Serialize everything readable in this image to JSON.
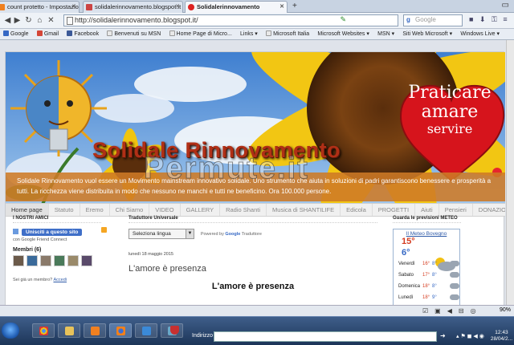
{
  "browser": {
    "tabs": [
      {
        "label": "count protetto - Impostazioni...",
        "icon": "blogger-icon",
        "active": false
      },
      {
        "label": "solidalerinnovamento.blogspot.it - Commu...",
        "icon": "blogger-icon",
        "active": false
      },
      {
        "label": "Solidalerinnovamento",
        "icon": "heart-icon",
        "active": true
      }
    ],
    "new_tab": "+",
    "url": "http://solidalerinnovamento.blogspot.it/",
    "search_placeholder": "Google",
    "bookmarks": [
      {
        "label": "Google",
        "icon": "google-icon",
        "color": "#3568c4"
      },
      {
        "label": "Gmail",
        "icon": "gmail-icon",
        "color": "#d44638"
      },
      {
        "label": "Facebook",
        "icon": "facebook-icon",
        "color": "#3b5998"
      },
      {
        "label": "Benvenuti su MSN",
        "icon": "msn-icon",
        "color": "#7a9bc8"
      },
      {
        "label": "Home Page di Micro...",
        "icon": "page-icon",
        "color": "#eeeeee"
      },
      {
        "label": "Links ▾",
        "icon": "",
        "color": ""
      },
      {
        "label": "Microsoft Italia",
        "icon": "page-icon",
        "color": "#eeeeee"
      },
      {
        "label": "Microsoft Websites ▾",
        "icon": "",
        "color": ""
      },
      {
        "label": "MSN ▾",
        "icon": "",
        "color": ""
      },
      {
        "label": "Siti Web Microsoft ▾",
        "icon": "",
        "color": ""
      },
      {
        "label": "Windows Live ▾",
        "icon": "",
        "color": ""
      }
    ]
  },
  "blog": {
    "title": "Solidale Rinnovamento",
    "watermark": "Permute.it",
    "heart_lines": [
      "Praticare",
      "amare",
      "servire"
    ],
    "description": "Solidale Rinnovamento vuol essere un Movimento mainstream innovativo solidale. Uno strumento che aiuta in soluzioni di padri garantiscono benessere e prosperità a tutti. La ricchezza viene distribuita in modo che nessuno ne manchi e tutti ne beneficino. Ora 100.000 persone.",
    "menu": [
      "Home page",
      "Statuto",
      "Eremo",
      "Chi Siamo",
      "VIDEO",
      "GALLERY",
      "Radio Shanti",
      "Musica di SHANTILIFE",
      "Edicola",
      "PROGETTI",
      "Aiuti",
      "Pensieri",
      "DONAZIONI"
    ]
  },
  "left": {
    "heading": "I NOSTRI AMICI",
    "follow_button": "Unisciti a questo sito",
    "gfc_text": "con Google Friend Connect",
    "members_title": "Membri (6)",
    "already": "Sei già un membro?",
    "login": "Accedi"
  },
  "middle": {
    "heading": "Traduttore Universale",
    "lang_select": "Seleziona lingua",
    "powered": "Powered by",
    "google": "Google",
    "translate": "Traduttore",
    "date": "lunedì 18 maggio 2015",
    "post_title": "L'amore è presenza",
    "post_heading": "L'amore è presenza"
  },
  "right": {
    "heading": "Guarda le previsioni METEO",
    "link": "Il Meteo Bovegno",
    "max": "15°",
    "min": "6°",
    "days": [
      {
        "day": "Venerdì",
        "hi": "16°",
        "lo": "8°"
      },
      {
        "day": "Sabato",
        "hi": "17°",
        "lo": "8°"
      },
      {
        "day": "Domenica",
        "hi": "18°",
        "lo": "8°"
      },
      {
        "day": "Lunedì",
        "hi": "18°",
        "lo": "9°"
      }
    ]
  },
  "taskbar": {
    "address_label": "Indirizzo",
    "time": "12:43",
    "date": "28/04/2..."
  },
  "status": {
    "zoom": "90%"
  }
}
